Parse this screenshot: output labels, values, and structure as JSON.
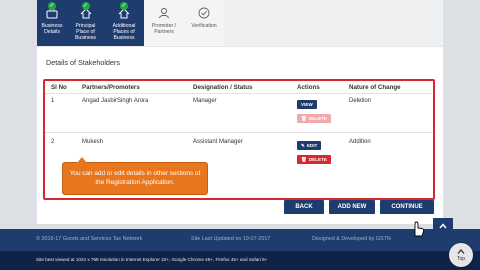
{
  "steps": [
    {
      "label_1": "Business",
      "label_2": "Details",
      "label_3": "",
      "state": "done",
      "icon": "briefcase-icon"
    },
    {
      "label_1": "Principal",
      "label_2": "Place of",
      "label_3": "Business",
      "state": "done",
      "icon": "home-icon"
    },
    {
      "label_1": "Additional",
      "label_2": "Places of",
      "label_3": "Business",
      "state": "done",
      "icon": "home-icon"
    },
    {
      "label_1": "Promoter /",
      "label_2": "Partners",
      "label_3": "",
      "state": "active",
      "icon": "person-icon"
    },
    {
      "label_1": "Verification",
      "label_2": "",
      "label_3": "",
      "state": "pending",
      "icon": "check-circle-icon"
    }
  ],
  "section": {
    "title": "Details of Stakeholders"
  },
  "table": {
    "headers": [
      "Sl No",
      "Partners/Promoters",
      "Designation / Status",
      "Actions",
      "Nature of Change"
    ],
    "rows": [
      {
        "sl": "1",
        "name": "Angad JasbirSingh Arora",
        "designation": "Manager",
        "nature": "Deletion",
        "btn_top": "VIEW",
        "btn_bottom": "DELETE"
      },
      {
        "sl": "2",
        "name": "Mukesh",
        "designation": "Assistant Manager",
        "nature": "Addition",
        "btn_top": "EDIT",
        "btn_bottom": "DELETE"
      }
    ]
  },
  "tooltip": {
    "text": "You can add or edit details in other sections of the Registration Application."
  },
  "buttons": {
    "back": "BACK",
    "add_new": "ADD NEW",
    "continue": "CONTINUE"
  },
  "footer": {
    "copyright": "© 2016-17 Goods and Services Tax Network",
    "updated": "Site Last Updated on 19-07-2017",
    "designed": "Designed & Developed by GSTN",
    "browser_note": "Site best viewed at 1024 x 768 resolution in Internet Explorer 10+, Google Chrome 49+, Firefox 45+ and Safari 6+",
    "top_label": "Top"
  },
  "colors": {
    "navy": "#1e3c6e",
    "red": "#d9272f",
    "orange": "#e8761c",
    "green": "#22a844"
  }
}
